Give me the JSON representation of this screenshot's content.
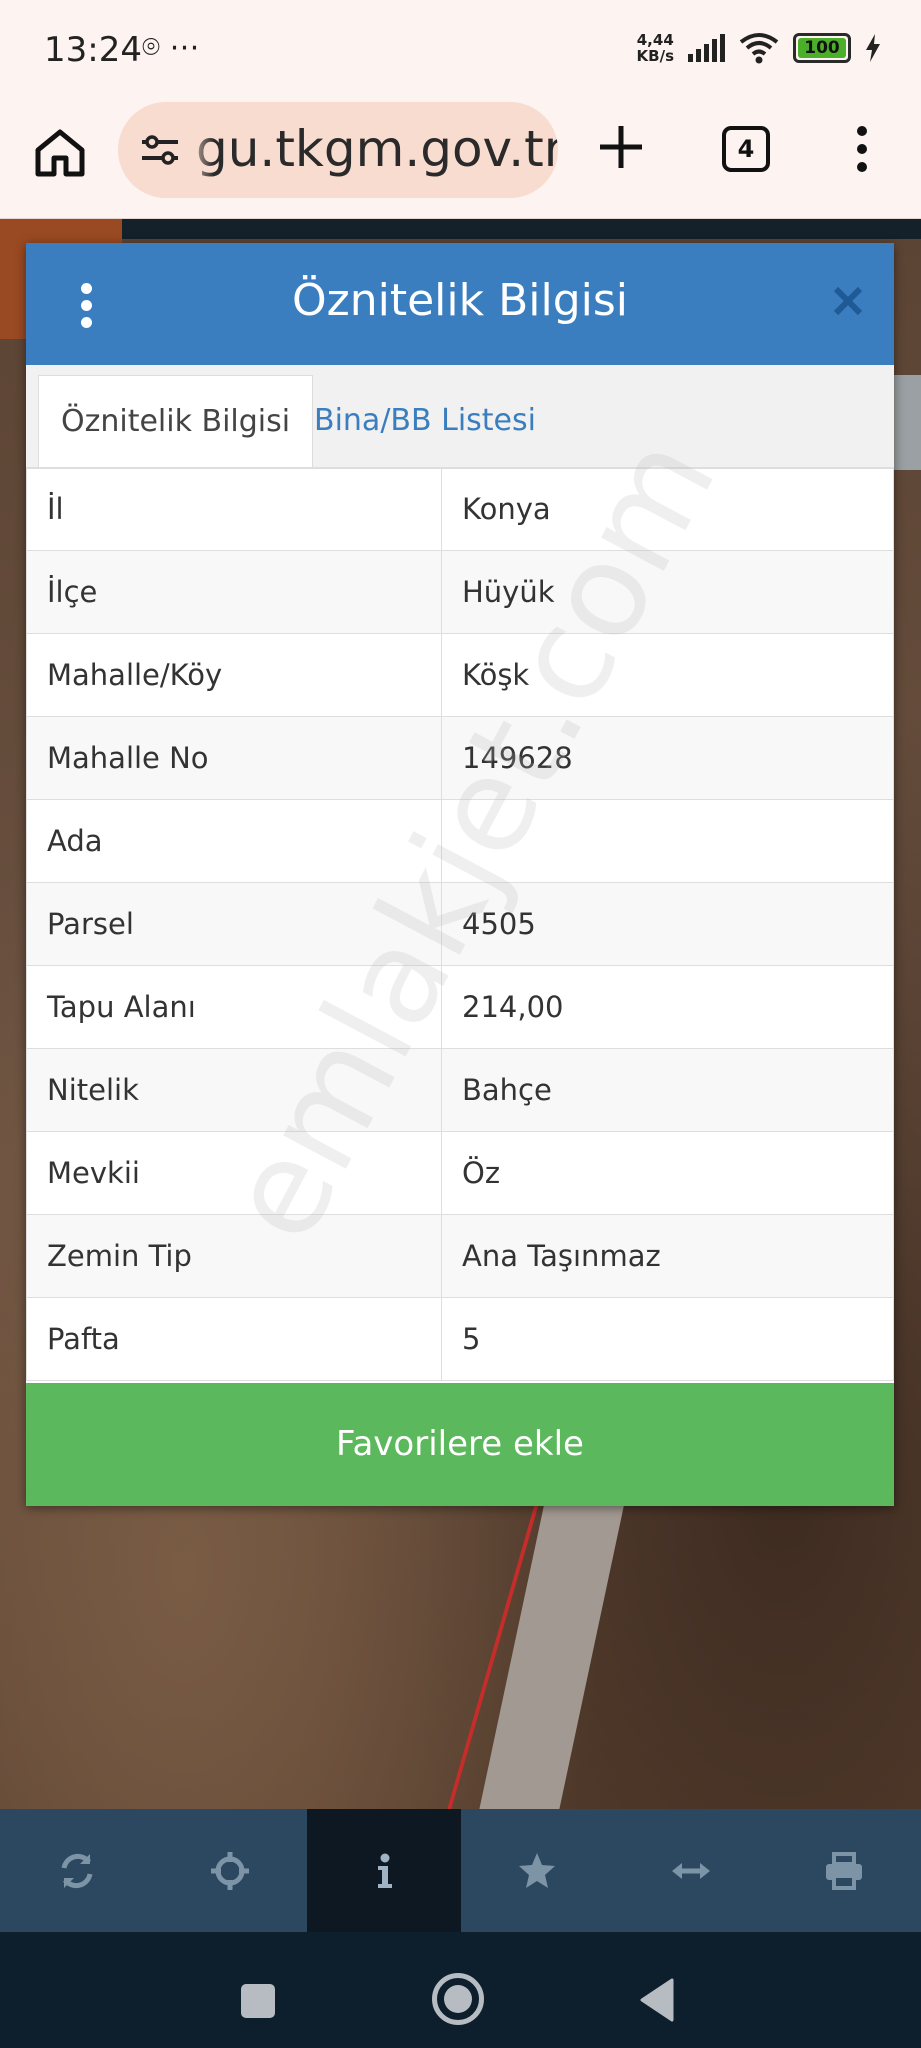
{
  "status_bar": {
    "time": "13:24",
    "notif_icons": "⌾ ⋯",
    "net_speed_value": "4,44",
    "net_speed_unit": "KB/s",
    "battery": "100"
  },
  "browser": {
    "url": "gu.tkgm.gov.tr",
    "tab_count": "4"
  },
  "dialog": {
    "title": "Öznitelik Bilgisi",
    "tabs": [
      {
        "label": "Öznitelik Bilgisi",
        "active": true
      },
      {
        "label": "Bina/BB Listesi",
        "active": false
      }
    ],
    "rows": [
      {
        "key": "İl",
        "value": "Konya"
      },
      {
        "key": "İlçe",
        "value": "Hüyük"
      },
      {
        "key": "Mahalle/Köy",
        "value": "Köşk"
      },
      {
        "key": "Mahalle No",
        "value": "149628"
      },
      {
        "key": "Ada",
        "value": ""
      },
      {
        "key": "Parsel",
        "value": "4505"
      },
      {
        "key": "Tapu Alanı",
        "value": "214,00"
      },
      {
        "key": "Nitelik",
        "value": "Bahçe"
      },
      {
        "key": "Mevkii",
        "value": "Öz"
      },
      {
        "key": "Zemin Tip",
        "value": "Ana Taşınmaz"
      },
      {
        "key": "Pafta",
        "value": "5"
      }
    ],
    "favorite_button": "Favorilere ekle"
  },
  "watermark": "emlakjet.com",
  "toolbar": {
    "items": [
      {
        "icon": "refresh-icon",
        "active": false
      },
      {
        "icon": "crosshair-icon",
        "active": false
      },
      {
        "icon": "info-icon",
        "active": true
      },
      {
        "icon": "star-icon",
        "active": false
      },
      {
        "icon": "measure-icon",
        "active": false
      },
      {
        "icon": "print-icon",
        "active": false
      }
    ]
  },
  "colors": {
    "header_blue": "#3a7ebf",
    "favorite_green": "#5cb85c",
    "toolbar_bg": "#2c4860"
  }
}
